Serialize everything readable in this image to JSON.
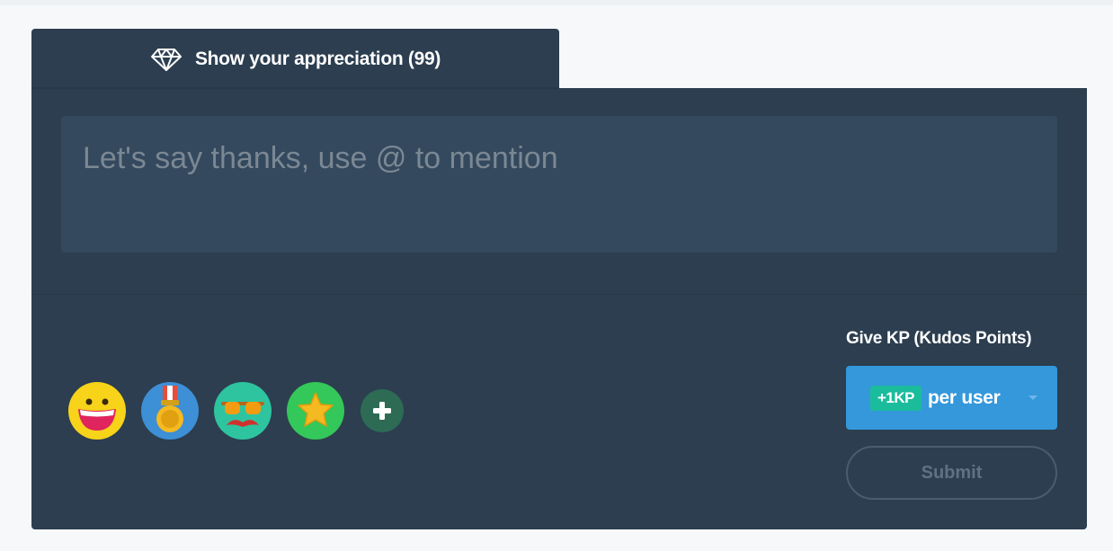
{
  "tab": {
    "icon": "diamond-icon",
    "label": "Show your appreciation (99)"
  },
  "message": {
    "placeholder": "Let's say thanks, use @ to mention",
    "value": ""
  },
  "emojis": [
    {
      "name": "smiley-face-icon"
    },
    {
      "name": "gold-medal-icon"
    },
    {
      "name": "mustache-glasses-icon"
    },
    {
      "name": "star-icon"
    }
  ],
  "add_emoji": {
    "icon": "plus-icon"
  },
  "kudos": {
    "label": "Give KP (Kudos Points)",
    "badge": "+1KP",
    "unit": "per user"
  },
  "submit_label": "Submit",
  "colors": {
    "panel": "#2c3e50",
    "input": "#34495e",
    "accent_blue": "#3498db",
    "accent_green": "#1abc9c"
  }
}
